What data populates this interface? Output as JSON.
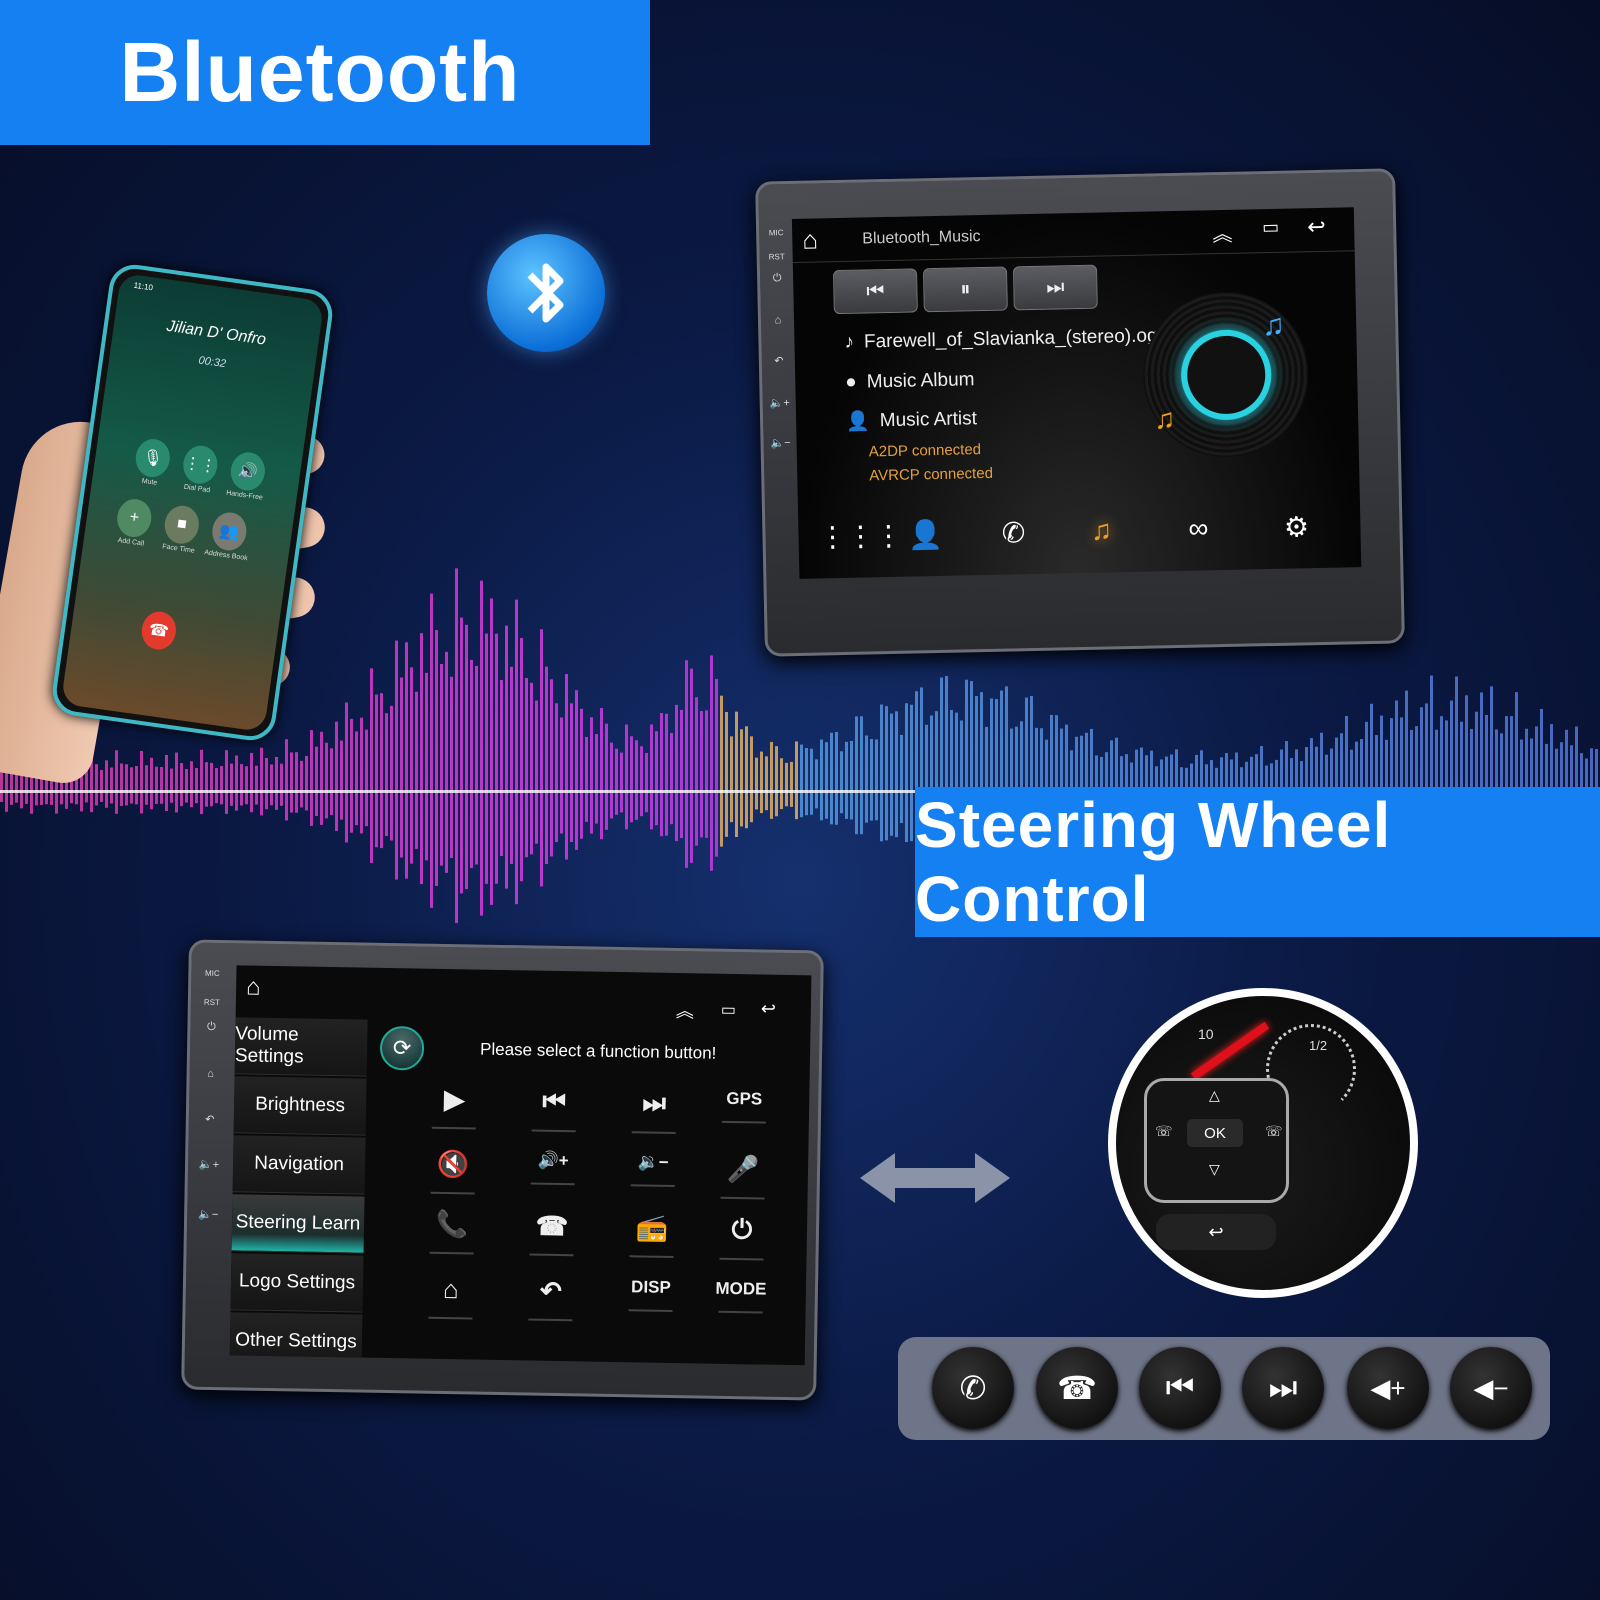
{
  "banners": {
    "bluetooth": "Bluetooth",
    "steering": "Steering Wheel Control"
  },
  "colors": {
    "banner_blue": "#1580f2",
    "accent_orange": "#e4a13a",
    "accent_teal": "#2ad1e0"
  },
  "phone": {
    "status_time": "11:10",
    "caller": "Jilian D' Onfro",
    "duration": "00:32",
    "buttons": [
      {
        "label": "Mute",
        "icon": "mute-icon"
      },
      {
        "label": "Dial Pad",
        "icon": "dialpad-icon"
      },
      {
        "label": "Hands-Free",
        "icon": "speaker-icon"
      },
      {
        "label": "Add Call",
        "icon": "plus-icon"
      },
      {
        "label": "Face Time",
        "icon": "video-icon"
      },
      {
        "label": "Address Book",
        "icon": "contacts-icon"
      }
    ]
  },
  "top_unit": {
    "side_labels": {
      "mic": "MIC",
      "rst": "RST"
    },
    "title": "Bluetooth_Music",
    "track": "Farewell_of_Slavianka_(stereo).ogg",
    "album": "Music Album",
    "artist": "Music Artist",
    "status": [
      "A2DP connected",
      "AVRCP connected"
    ],
    "dock": [
      "dialpad-icon",
      "contacts-icon",
      "call-log-icon",
      "music-icon",
      "link-icon",
      "settings-icon"
    ],
    "active_dock": "music-icon"
  },
  "bottom_unit": {
    "side_labels": {
      "mic": "MIC",
      "rst": "RST"
    },
    "prompt": "Please select a function button!",
    "menu": [
      "Volume Settings",
      "Brightness",
      "Navigation",
      "Steering Learn",
      "Logo Settings",
      "Other Settings"
    ],
    "active_menu": "Steering Learn",
    "functions": [
      "▶",
      "⏮",
      "⏭",
      "GPS",
      "🔇",
      "🔊+",
      "🔉−",
      "🎤",
      "📞",
      "☎",
      "📻",
      "⏻",
      "⌂",
      "↶",
      "DISP",
      "MODE"
    ]
  },
  "steering": {
    "ok": "OK",
    "gauge_label": "1/2",
    "speed_label": "10"
  },
  "steering_buttons": [
    "call-icon",
    "hangup-icon",
    "previous-icon",
    "next-icon",
    "volume-up-icon",
    "volume-down-icon"
  ]
}
